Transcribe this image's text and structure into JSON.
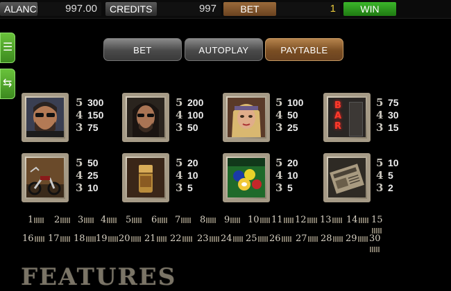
{
  "topbar": {
    "balance_label": "ALANCE",
    "balance_value": "997.00",
    "credits_label": "CREDITS",
    "credits_value": "997",
    "bet_label": "BET",
    "bet_value": "1",
    "win_label": "WIN"
  },
  "side": {
    "menu_icon": "menu-icon",
    "settings_icon": "sliders-icon"
  },
  "tabs": [
    {
      "label": "BET"
    },
    {
      "label": "AUTOPLAY"
    },
    {
      "label": "PAYTABLE"
    }
  ],
  "symbols": [
    {
      "name": "biker-sunglasses",
      "pays": [
        [
          "5",
          "300"
        ],
        [
          "4",
          "150"
        ],
        [
          "3",
          "75"
        ]
      ]
    },
    {
      "name": "longhair-biker",
      "pays": [
        [
          "5",
          "200"
        ],
        [
          "4",
          "100"
        ],
        [
          "3",
          "50"
        ]
      ]
    },
    {
      "name": "blonde-woman",
      "pays": [
        [
          "5",
          "100"
        ],
        [
          "4",
          "50"
        ],
        [
          "3",
          "25"
        ]
      ]
    },
    {
      "name": "bar-sign",
      "sign_text": "BAR",
      "pays": [
        [
          "5",
          "75"
        ],
        [
          "4",
          "30"
        ],
        [
          "3",
          "15"
        ]
      ]
    },
    {
      "name": "motorcycles",
      "pays": [
        [
          "5",
          "50"
        ],
        [
          "4",
          "25"
        ],
        [
          "3",
          "10"
        ]
      ]
    },
    {
      "name": "zippo-lighter",
      "pays": [
        [
          "5",
          "20"
        ],
        [
          "4",
          "10"
        ],
        [
          "3",
          "5"
        ]
      ]
    },
    {
      "name": "pool-balls",
      "pays": [
        [
          "5",
          "20"
        ],
        [
          "4",
          "10"
        ],
        [
          "3",
          "5"
        ]
      ]
    },
    {
      "name": "newspaper",
      "pays": [
        [
          "5",
          "10"
        ],
        [
          "4",
          "5"
        ],
        [
          "3",
          "2"
        ]
      ]
    }
  ],
  "paylines_row1": [
    "1",
    "2",
    "3",
    "4",
    "5",
    "6",
    "7",
    "8",
    "9",
    "10",
    "11",
    "12",
    "13",
    "14",
    "15"
  ],
  "paylines_row2": [
    "16",
    "17",
    "18",
    "19",
    "20",
    "21",
    "22",
    "23",
    "24",
    "25",
    "26",
    "27",
    "28",
    "29",
    "30"
  ],
  "features_title": "FEATURES",
  "colors": {
    "accent": "#8a5a2a",
    "win_green": "#2e9a1e",
    "side_green": "#58b02f"
  }
}
